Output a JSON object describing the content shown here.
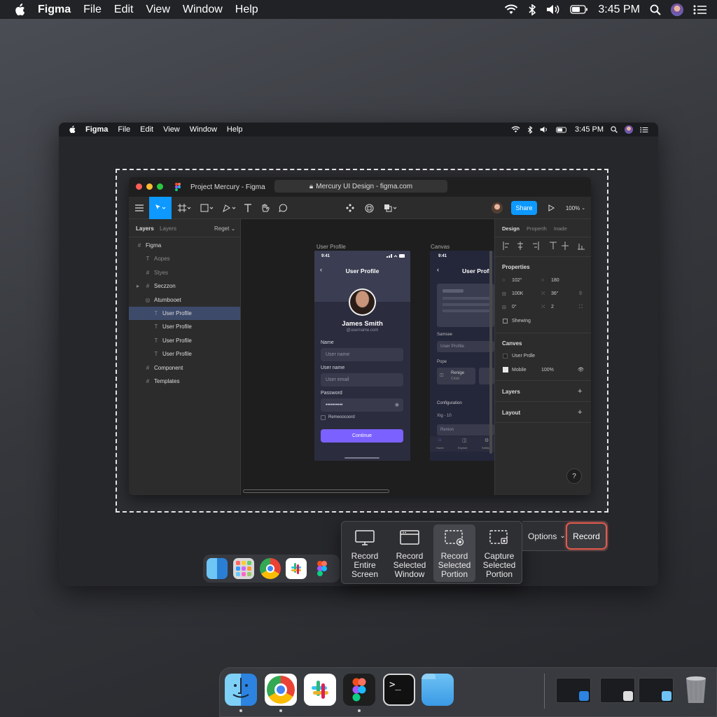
{
  "menubar": {
    "app": "Figma",
    "items": [
      "File",
      "Edit",
      "View",
      "Window",
      "Help"
    ],
    "time": "3:45 PM",
    "status_icons": [
      "wifi-icon",
      "bluetooth-icon",
      "volume-icon",
      "battery-icon",
      "search-icon",
      "user-avatar",
      "control-center-icon"
    ]
  },
  "inner_menubar": {
    "app": "Figma",
    "items": [
      "File",
      "Edit",
      "View",
      "Window",
      "Help"
    ],
    "time": "3:45 PM"
  },
  "figma_window": {
    "title": "Project Mercury - Figma",
    "url": "Mercury UI Design - figma.com",
    "share_label": "Share",
    "zoom": "100%",
    "left_panel": {
      "tab_active": "Layers",
      "tab_inactive": "Layers",
      "page_select": "Reget",
      "layers": [
        {
          "label": "Figma",
          "icon": "#"
        },
        {
          "label": "Aopes",
          "icon": "T"
        },
        {
          "label": "Styes",
          "icon": "#"
        },
        {
          "label": "Seczzon",
          "icon": "#"
        },
        {
          "label": "Atumbooet",
          "icon": "◎"
        },
        {
          "label": "User Profile",
          "icon": "T"
        },
        {
          "label": "User Profile",
          "icon": "T"
        },
        {
          "label": "User Profile",
          "icon": "T"
        },
        {
          "label": "User Profile",
          "icon": "T"
        },
        {
          "label": "Component",
          "icon": "#"
        },
        {
          "label": "Templates",
          "icon": "#"
        }
      ]
    },
    "canvas": {
      "frame1_label": "User Profile",
      "frame2_label": "Canvas",
      "phone1": {
        "status_time": "9:41",
        "header": "User Profile",
        "name": "James Smith",
        "handle": "@username.com",
        "name_label": "Name",
        "name_placeholder": "User name",
        "username_label": "User name",
        "username_placeholder": "User email",
        "password_label": "Password",
        "password_value": "••••••••••",
        "remember_label": "Remeoocoord",
        "continue_label": "Continue"
      },
      "phone2": {
        "status_time": "9:41",
        "header": "User Profi",
        "section1": "Samsee",
        "field1": "User Profile",
        "section2": "Pope",
        "card_title": "Renige",
        "card_sub": "Crtiot",
        "section3": "Configuration",
        "config_value": "Xig - 10",
        "button_label": "Renion",
        "tabs": [
          "Home",
          "Explore",
          "Settings"
        ]
      }
    },
    "right_panel": {
      "tabs": [
        "Design",
        "Properth",
        "Inade"
      ],
      "properties_title": "Properties",
      "props": [
        {
          "a": "102°",
          "b": "180"
        },
        {
          "a": "100K",
          "b": "36°"
        },
        {
          "a": "0°",
          "b": "2"
        }
      ],
      "showing_label": "Shewing",
      "canvas_title": "Canves",
      "canvas_item": "User Prdle",
      "mobile_label": "Mobile",
      "mobile_value": "100%",
      "layers_title": "Layers",
      "layout_title": "Layout",
      "help": "?"
    }
  },
  "recording_toolbar": {
    "buttons": [
      {
        "label": "Record\nEntire\nScreen",
        "icon": "monitor-icon"
      },
      {
        "label": "Record\nSelected\nWindow",
        "icon": "window-icon"
      },
      {
        "label": "Record\nSelected\nPortion",
        "icon": "selection-record-icon"
      },
      {
        "label": "Capture\nSelected\nPortion",
        "icon": "selection-capture-icon"
      }
    ],
    "options_label": "Options",
    "record_label": "Record"
  },
  "dock": {
    "apps": [
      "Finder",
      "Chrome",
      "Slack",
      "Figma",
      "Terminal",
      "Folder"
    ]
  }
}
